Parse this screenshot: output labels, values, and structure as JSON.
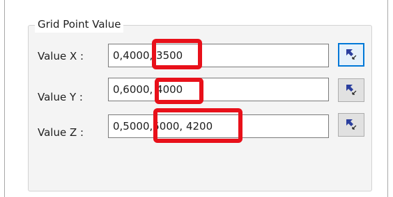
{
  "group": {
    "title": "Grid Point Value"
  },
  "rows": [
    {
      "label": "Value X :",
      "value": "0,4000, 3500",
      "button_icon": "pick-point-icon"
    },
    {
      "label": "Value Y :",
      "value": "0,6000, 4000",
      "button_icon": "pick-point-icon"
    },
    {
      "label": "Value Z :",
      "value": "0,5000,5000, 4200",
      "button_icon": "pick-point-icon"
    }
  ],
  "colors": {
    "highlight": "#e8101a",
    "focus": "#0078d7",
    "icon": "#2b3f9e"
  }
}
